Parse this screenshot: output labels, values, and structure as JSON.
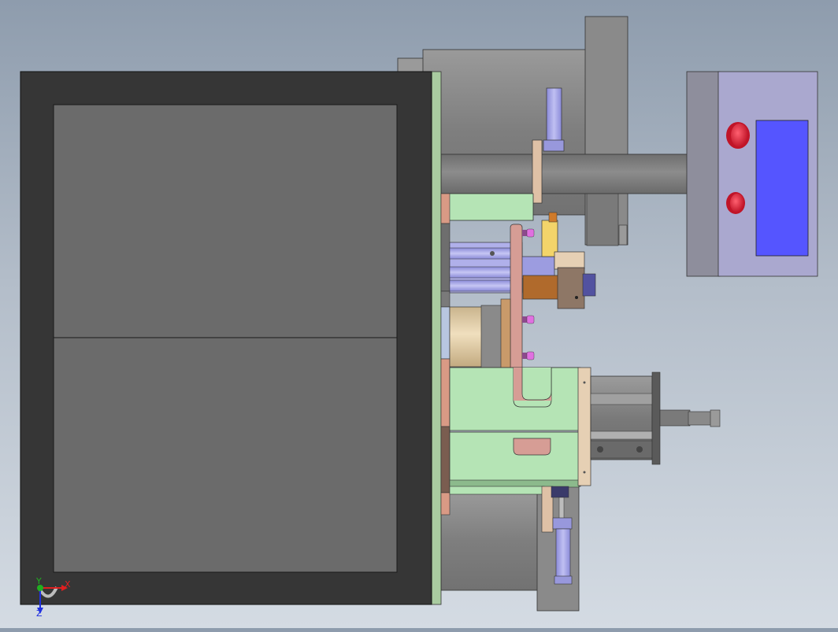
{
  "app": {
    "view_type": "cad-assembly-side-view",
    "background_gradient": [
      "#8e9cad",
      "#d4dbe3"
    ]
  },
  "triad": {
    "x_label": "X",
    "y_label": "Y",
    "z_label": "Z",
    "x_color": "#e02020",
    "y_color": "#20b020",
    "z_color": "#2030e0"
  },
  "colors": {
    "frame": "#363636",
    "panel": "#6b6b6b",
    "mount_plate": "#a9cba0",
    "bracket_green": "#b5e4b5",
    "motor_grey": "#8c8c8c",
    "control_box": "#a8a6cc",
    "display_screen": "#5555ff",
    "button_red": "#e8203a",
    "cylinder_blue": "#a6a6e6",
    "bolt_pink": "#e070e0",
    "sensor_yellow": "#f3d46a",
    "copper": "#b06a2c",
    "beige_roller": "#e3cfaa"
  },
  "icons": [
    "coordinate-triad-icon"
  ]
}
